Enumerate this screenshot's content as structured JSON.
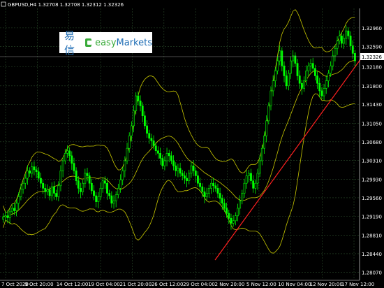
{
  "chart_data": {
    "type": "candlestick",
    "title": "GBPUSD,H4  1.32708 1.32708 1.32312 1.32326",
    "symbol": "GBPUSD",
    "timeframe": "H4",
    "ohlc_header": {
      "open": 1.32708,
      "high": 1.32708,
      "low": 1.32312,
      "close": 1.32326
    },
    "current_price": "1.32326",
    "price_ticks": [
      "1.32960",
      "1.32590",
      "1.32180",
      "1.31800",
      "1.31430",
      "1.31050",
      "1.30680",
      "1.30310",
      "1.29930",
      "1.29560",
      "1.29190",
      "1.28810",
      "1.28440",
      "1.28070"
    ],
    "time_ticks": [
      "7 Oct 2020",
      "9 Oct 20:00",
      "14 Oct 12:00",
      "19 Oct 04:00",
      "21 Oct 20:00",
      "26 Oct 12:00",
      "29 Oct 04:00",
      "2 Nov 20:00",
      "5 Nov 12:00",
      "10 Nov 04:00",
      "12 Nov 20:00",
      "17 Nov 12:00"
    ],
    "ylim": [
      1.2795,
      1.3335
    ],
    "grid": true,
    "indicators": [
      "Bollinger Bands",
      "Trendline"
    ],
    "colors": {
      "bull_candle": "#00ff00",
      "bear_candle": "#00ff00",
      "bands": "#c8c800",
      "trendline": "#ff2020",
      "price_tag": "#ffffff"
    },
    "candles_approx_close": [
      1.2918,
      1.292,
      1.2916,
      1.2928,
      1.2935,
      1.293,
      1.2945,
      1.2958,
      1.2973,
      1.2985,
      1.2995,
      1.301,
      1.3005,
      1.3018,
      1.3012,
      1.3008,
      1.2995,
      1.2985,
      1.2975,
      1.2968,
      1.2972,
      1.296,
      1.2978,
      1.2965,
      1.2958,
      1.298,
      1.301,
      1.303,
      1.3045,
      1.305,
      1.304,
      1.3025,
      1.301,
      1.299,
      1.2975,
      1.2968,
      1.2985,
      1.3005,
      1.3,
      1.2985,
      1.297,
      1.296,
      1.2948,
      1.2958,
      1.2975,
      1.299,
      1.2985,
      1.2965,
      1.296,
      1.2945,
      1.295,
      1.2962,
      1.2975,
      1.2992,
      1.301,
      1.303,
      1.3055,
      1.308,
      1.31,
      1.313,
      1.316,
      1.315,
      1.314,
      1.312,
      1.31,
      1.3085,
      1.3075,
      1.307,
      1.306,
      1.305,
      1.3045,
      1.3035,
      1.302,
      1.303,
      1.3045,
      1.304,
      1.303,
      1.302,
      1.301,
      1.3015,
      1.3005,
      1.3,
      1.2995,
      1.299,
      1.3005,
      1.302,
      1.301,
      1.3,
      1.2985,
      1.2978,
      1.2968,
      1.2958,
      1.2965,
      1.2975,
      1.2985,
      1.298,
      1.2975,
      1.2965,
      1.2955,
      1.2945,
      1.2935,
      1.2925,
      1.2915,
      1.2905,
      1.291,
      1.292,
      1.2935,
      1.295,
      1.2965,
      1.2985,
      1.3,
      1.3005,
      1.299,
      1.2975,
      1.2985,
      1.3005,
      1.303,
      1.3055,
      1.308,
      1.311,
      1.314,
      1.317,
      1.319,
      1.321,
      1.323,
      1.325,
      1.322,
      1.32,
      1.318,
      1.3205,
      1.323,
      1.324,
      1.3225,
      1.32,
      1.3185,
      1.3175,
      1.319,
      1.321,
      1.322,
      1.3225,
      1.3215,
      1.32,
      1.3185,
      1.317,
      1.316,
      1.3175,
      1.319,
      1.3205,
      1.322,
      1.324,
      1.3255,
      1.327,
      1.328,
      1.3265,
      1.3275,
      1.329,
      1.328,
      1.326,
      1.3245,
      1.323
    ]
  },
  "logo": {
    "cn": "易信",
    "easy": "easy",
    "markets": "Markets"
  }
}
